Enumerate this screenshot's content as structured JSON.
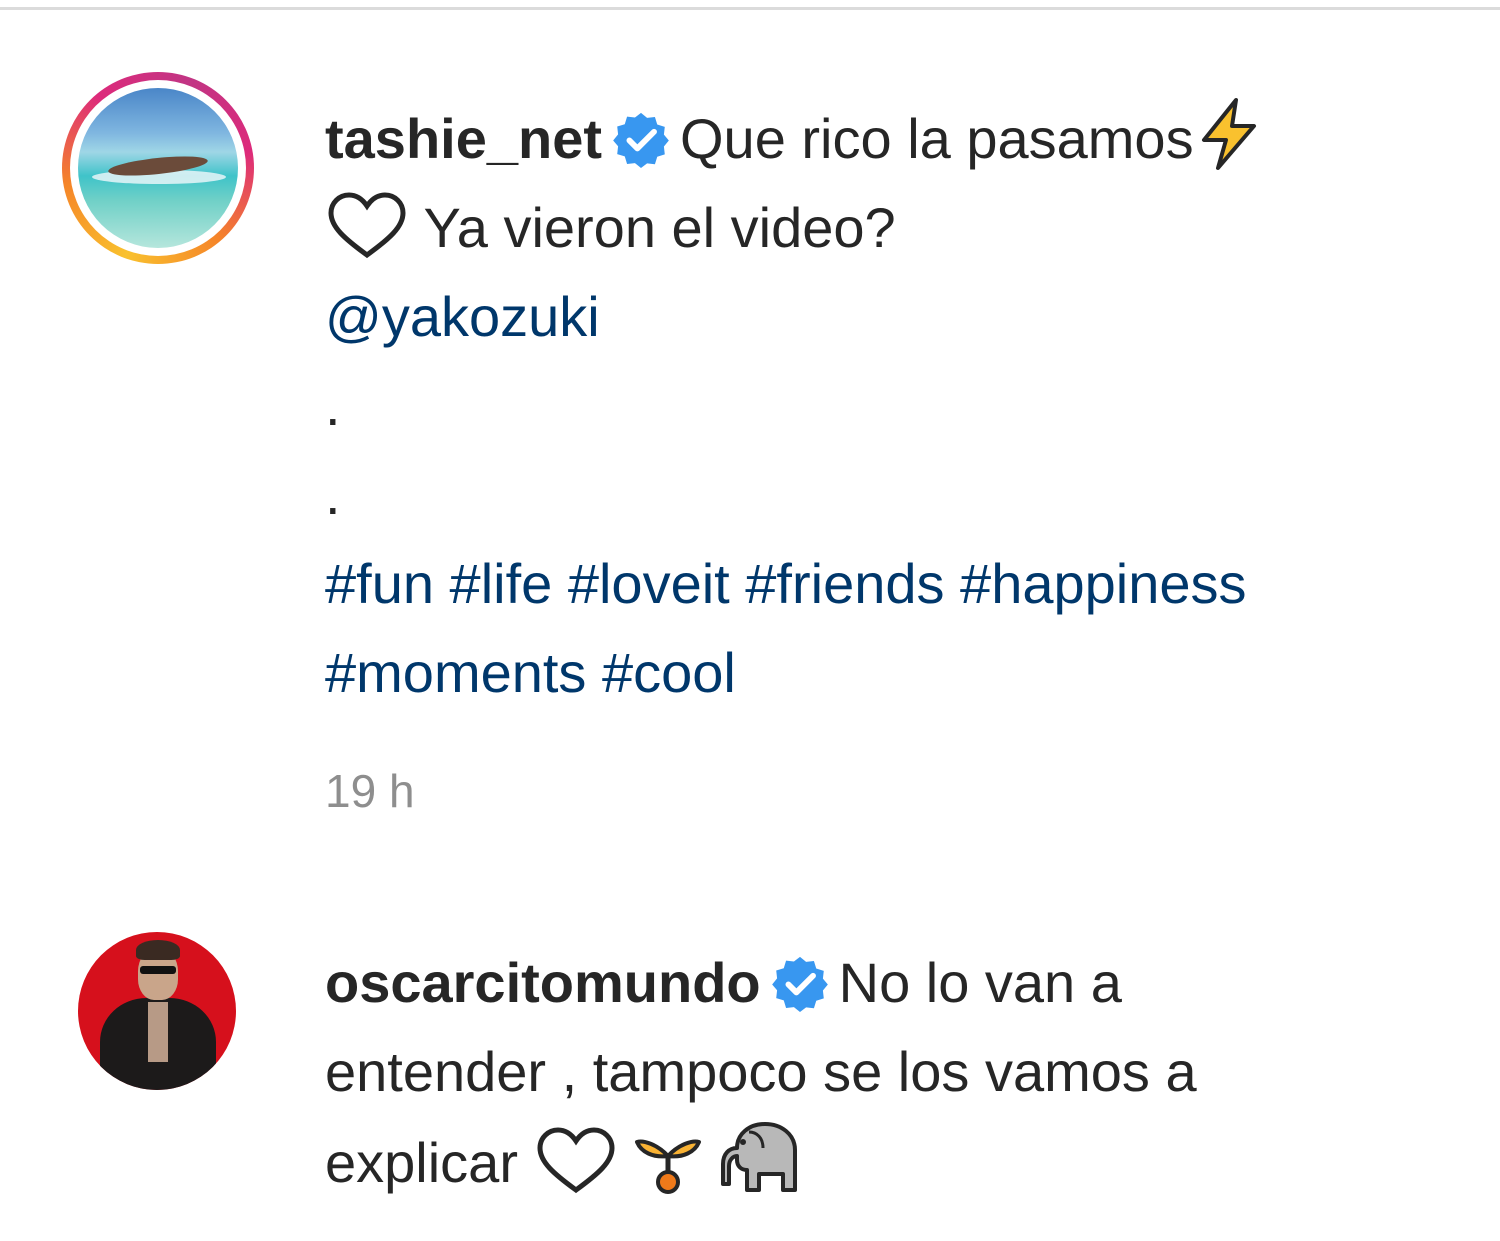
{
  "comments": [
    {
      "username": "tashie_net",
      "verified": true,
      "avatar_icon": "beach-photo-avatar",
      "caption_line1": "Que rico la pasamos",
      "emoji_1": "lightning-icon",
      "caption_line2": "Ya vieron el video?",
      "emoji_2": "white-heart-icon",
      "mention": "@yakozuki",
      "dots": [
        ".",
        "."
      ],
      "hashtags_line1": "#fun #life #loveit #friends #happiness",
      "hashtags_line2": "#moments #cool",
      "timestamp": "19 h"
    },
    {
      "username": "oscarcitomundo",
      "verified": true,
      "avatar_icon": "man-red-background-avatar",
      "text_line1": "No lo van a",
      "text_line2": "entender , tampoco se los vamos a",
      "text_line3": "explicar",
      "emojis": [
        "white-heart-icon",
        "herb-icon",
        "elephant-icon"
      ]
    }
  ],
  "colors": {
    "text": "#262626",
    "link": "#00376b",
    "muted": "#8e8e8e",
    "verified": "#3897f0",
    "divider": "#dbdbdb"
  }
}
